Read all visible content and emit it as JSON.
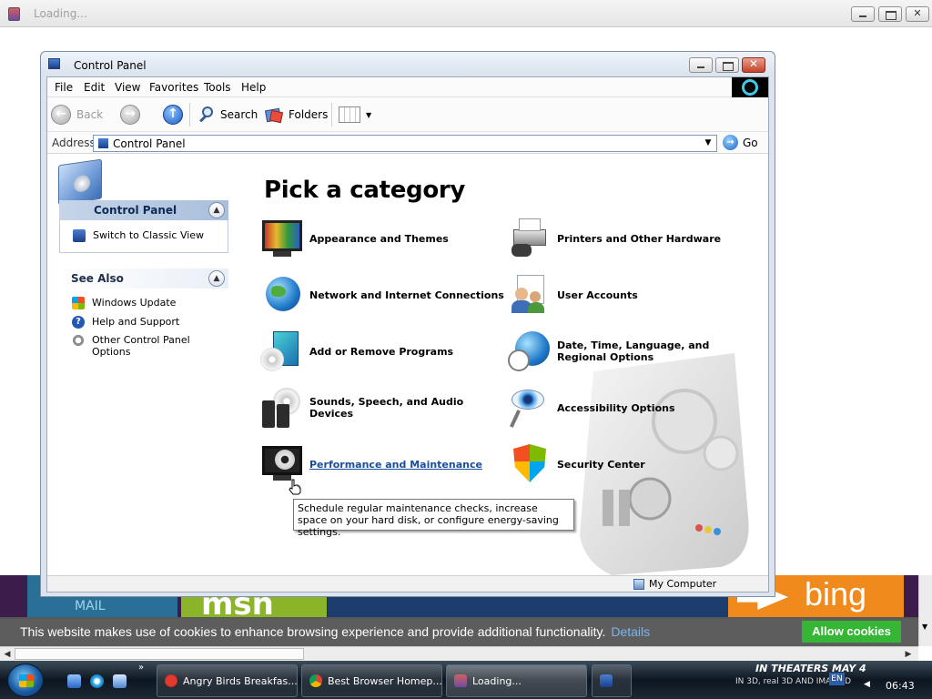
{
  "outer_window": {
    "title": "Loading..."
  },
  "cp_window": {
    "title": "Control Panel",
    "menu": [
      "File",
      "Edit",
      "View",
      "Favorites",
      "Tools",
      "Help"
    ],
    "toolbar": {
      "back": "Back",
      "search": "Search",
      "folders": "Folders"
    },
    "address": {
      "label": "Address",
      "value": "Control Panel",
      "go": "Go"
    },
    "left_pane": {
      "panel_title": "Control Panel",
      "switch_view": "Switch to Classic View",
      "see_also_title": "See Also",
      "see_also": [
        "Windows Update",
        "Help and Support",
        "Other Control Panel Options"
      ]
    },
    "heading": "Pick a category",
    "categories": [
      {
        "label": "Appearance and Themes",
        "icon": "monitor-theme-icon"
      },
      {
        "label": "Printers and Other Hardware",
        "icon": "printer-icon"
      },
      {
        "label": "Network and Internet Connections",
        "icon": "globe-network-icon"
      },
      {
        "label": "User Accounts",
        "icon": "users-icon"
      },
      {
        "label": "Add or Remove Programs",
        "icon": "programs-icon"
      },
      {
        "label": "Date, Time, Language, and Regional Options",
        "icon": "globe-clock-icon"
      },
      {
        "label": "Sounds, Speech, and Audio Devices",
        "icon": "speakers-icon"
      },
      {
        "label": "Accessibility Options",
        "icon": "accessibility-icon"
      },
      {
        "label": "Performance and Maintenance",
        "icon": "performance-icon",
        "hovered": true
      },
      {
        "label": "Security Center",
        "icon": "shield-icon"
      }
    ],
    "tooltip": "Schedule regular maintenance checks, increase space on your hard disk, or configure energy-saving settings.",
    "status": "My Computer"
  },
  "background_page": {
    "cookie_text": "This website makes use of cookies to enhance browsing experience and provide additional functionality.",
    "cookie_link": "Details",
    "cookie_button": "Allow cookies",
    "tiles": [
      "MAIL",
      "msn",
      "bing"
    ]
  },
  "taskbar": {
    "tasks": [
      {
        "label": "Angry Birds Breakfas...",
        "active": false
      },
      {
        "label": "Best Browser Homep...",
        "active": false
      },
      {
        "label": "Loading...",
        "active": true
      }
    ],
    "banner": "IN THEATERS MAY 4",
    "banner_sub": "IN 3D, real 3D AND IMAX 3D",
    "language": "EN",
    "clock": "06:43"
  },
  "colors": {
    "accent_blue": "#1a4d9c",
    "cookie_button": "#30b42f",
    "cookie_link": "#74b3f0",
    "msn_tile": "#8cb428",
    "bing_tile": "#f08a1c"
  }
}
